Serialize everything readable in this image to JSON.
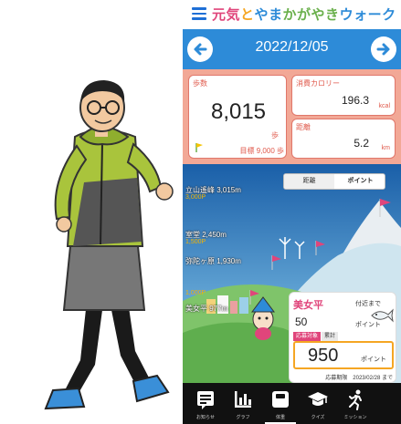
{
  "header": {
    "title_parts": [
      {
        "text": "元気",
        "color": "#e0457b"
      },
      {
        "text": "と",
        "color": "#f5a623"
      },
      {
        "text": "やま",
        "color": "#2d8bd8"
      },
      {
        "text": "かがやき",
        "color": "#6ab04c"
      },
      {
        "text": "ウォーク",
        "color": "#2d8bd8"
      }
    ],
    "menu_icon": "hamburger-icon"
  },
  "date_bar": {
    "date": "2022/12/05",
    "prev_icon": "arrow-left-icon",
    "next_icon": "arrow-right-icon",
    "color": "#2d8bd8"
  },
  "stats": {
    "steps": {
      "title": "歩数",
      "value": "8,015",
      "unit": "歩",
      "goal": "目標 9,000 歩"
    },
    "calories": {
      "title": "消費カロリー",
      "value": "196.3",
      "unit": "kcal"
    },
    "distance": {
      "title": "距離",
      "value": "5.2",
      "unit": "km"
    }
  },
  "toggle": {
    "distance_label": "距離",
    "points_label": "ポイント",
    "selected": "ポイント"
  },
  "landmarks": [
    {
      "name": "立山遙峰 3,015m",
      "points": "3,000P"
    },
    {
      "name": "室堂 2,450m",
      "points": "1,500P"
    },
    {
      "name": "弥陀ヶ原 1,930m",
      "points": "1,000P"
    },
    {
      "name": "美女平 977m",
      "points": ""
    }
  ],
  "landmark_extra_points": "1,000P",
  "info": {
    "destination": "美女平",
    "to_next_label": "付近まで",
    "remaining": "50",
    "remaining_unit": "ポイント",
    "apply_tag": "応募対象",
    "total_tag": "累計",
    "points": "950",
    "points_unit": "ポイント",
    "deadline": "応募期限　2023/02/28 まで"
  },
  "bottom_nav": [
    {
      "label": "お知らせ",
      "icon": "news-icon"
    },
    {
      "label": "グラフ",
      "icon": "bar-chart-icon"
    },
    {
      "label": "体重",
      "icon": "scale-icon"
    },
    {
      "label": "クイズ",
      "icon": "graduation-cap-icon"
    },
    {
      "label": "ミッション",
      "icon": "running-icon"
    }
  ],
  "colors": {
    "accent": "#2d8bd8",
    "stats_bg": "#f2a896",
    "nav_bg": "#111111",
    "points_border": "#f5a623"
  }
}
